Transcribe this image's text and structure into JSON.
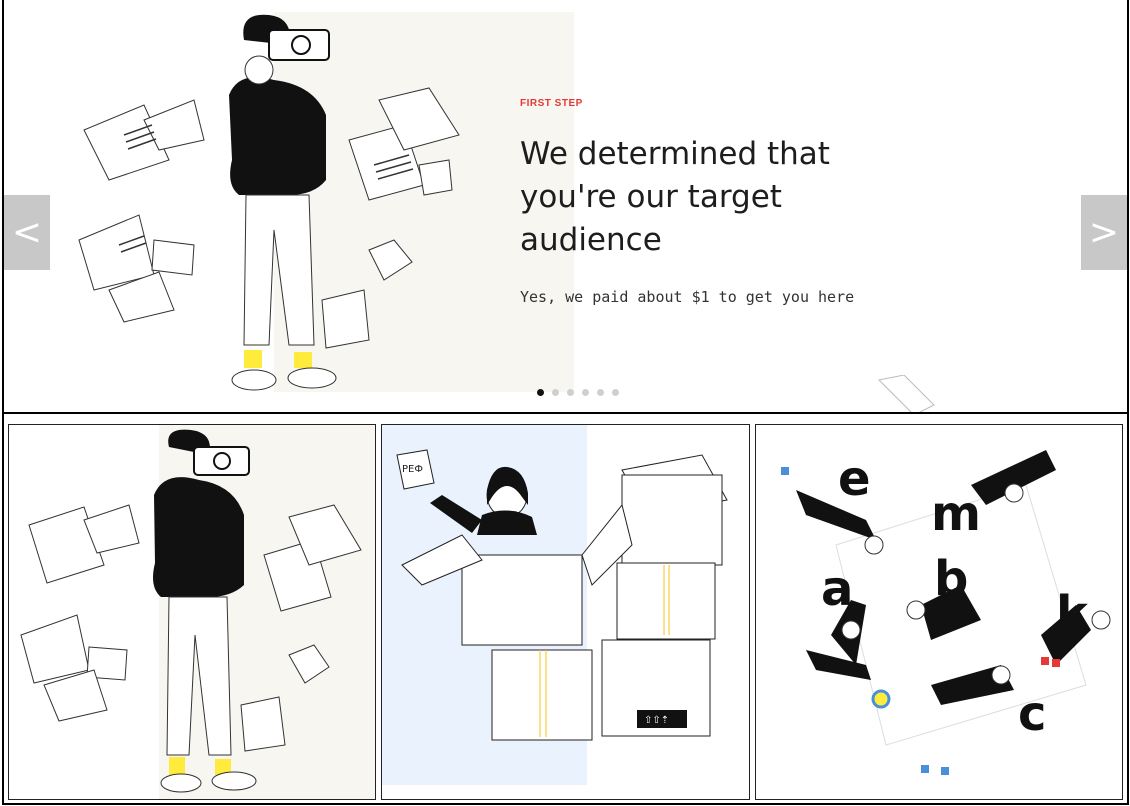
{
  "slider": {
    "eyebrow": "FIRST STEP",
    "headline": "We determined that you're our target audience",
    "subline": "Yes, we paid about $1 to get you here",
    "prev_label": "<",
    "next_label": ">",
    "active_dot": 0,
    "dot_count": 6,
    "accent_color": "#e53935"
  },
  "thumbnails": {
    "items": [
      {
        "id": "photographer"
      },
      {
        "id": "boxes",
        "book_label": "PEФ"
      },
      {
        "id": "letters",
        "letters": [
          "e",
          "m",
          "a",
          "b",
          "k",
          "c"
        ]
      }
    ]
  }
}
